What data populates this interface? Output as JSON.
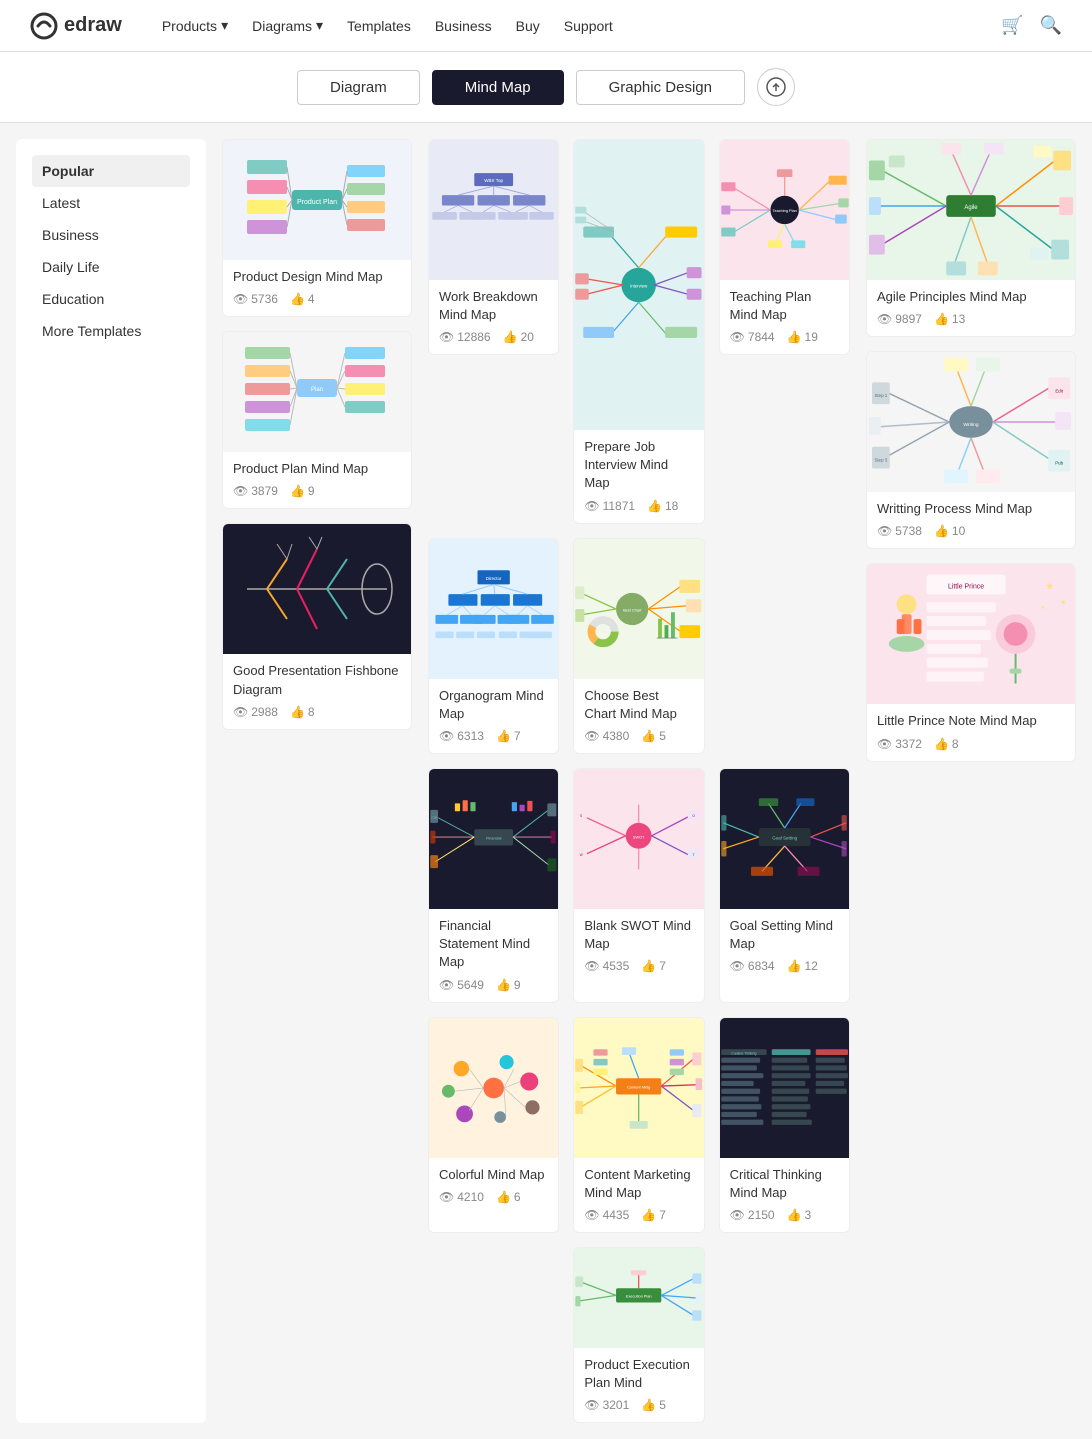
{
  "header": {
    "logo_text": "edraw",
    "nav_items": [
      {
        "label": "Products",
        "has_arrow": true
      },
      {
        "label": "Diagrams",
        "has_arrow": true
      },
      {
        "label": "Templates",
        "has_arrow": false
      },
      {
        "label": "Business",
        "has_arrow": false
      },
      {
        "label": "Buy",
        "has_arrow": false
      },
      {
        "label": "Support",
        "has_arrow": false
      }
    ]
  },
  "toolbar": {
    "tabs": [
      {
        "label": "Diagram",
        "active": false
      },
      {
        "label": "Mind Map",
        "active": true
      },
      {
        "label": "Graphic Design",
        "active": false
      }
    ],
    "upload_title": "Upload"
  },
  "sidebar": {
    "items": [
      {
        "label": "Popular",
        "active": true
      },
      {
        "label": "Latest",
        "active": false
      },
      {
        "label": "Business",
        "active": false
      },
      {
        "label": "Daily Life",
        "active": false
      },
      {
        "label": "Education",
        "active": false
      },
      {
        "label": "More Templates",
        "active": false
      }
    ]
  },
  "cards": {
    "side_col": [
      {
        "title": "Product Design Mind Map",
        "views": "5736",
        "likes": "4",
        "bg": "light",
        "colors": [
          "#7dc",
          "#f9a",
          "#9cf",
          "#fc9"
        ]
      },
      {
        "title": "Product Plan Mind Map",
        "views": "3879",
        "likes": "9",
        "bg": "light",
        "colors": [
          "#7dc",
          "#f9a",
          "#9cf"
        ]
      },
      {
        "title": "Good Presentation Fishbone Diagram",
        "views": "2988",
        "likes": "8",
        "bg": "dark"
      }
    ],
    "main_grid": [
      {
        "col": 0,
        "row": 0,
        "title": "Work Breakdown Mind Map",
        "views": "12886",
        "likes": "20",
        "bg": "light_blue"
      },
      {
        "col": 0,
        "row": 1,
        "title": "Organogram Mind Map",
        "views": "6313",
        "likes": "7",
        "bg": "blue_dark"
      },
      {
        "col": 0,
        "row": 2,
        "title": "Financial Statement Mind Map",
        "views": "5649",
        "likes": "9",
        "bg": "dark"
      },
      {
        "col": 0,
        "row": 3,
        "title": "Colorful Mind Map",
        "views": "4210",
        "likes": "6",
        "bg": "light"
      },
      {
        "col": 1,
        "row_span": 2,
        "title": "Prepare Job Interview Mind Map",
        "views": "11871",
        "likes": "18",
        "bg": "teal"
      },
      {
        "col": 1,
        "row": 1,
        "title": "Blank SWOT Mind Map",
        "views": "4535",
        "likes": "7",
        "bg": "pink"
      },
      {
        "col": 1,
        "row": 2,
        "title": "Content Marketing Mind Map",
        "views": "4435",
        "likes": "7",
        "bg": "colorful"
      },
      {
        "col": 1,
        "row": 3,
        "title": "Product Execution Plan Mind",
        "views": "3201",
        "likes": "5",
        "bg": "light"
      },
      {
        "col": 2,
        "row": 0,
        "title": "Teaching Plan Mind Map",
        "views": "7844",
        "likes": "19",
        "bg": "light"
      },
      {
        "col": 2,
        "row": 1,
        "title": "Choose Best Chart Mind Map",
        "views": "4380",
        "likes": "5",
        "bg": "light_green"
      },
      {
        "col": 2,
        "row": 2,
        "title": "Goal Setting Mind Map",
        "views": "6834",
        "likes": "12",
        "bg": "dark"
      },
      {
        "col": 2,
        "row": 3,
        "title": "Critical Thinking Mind Map",
        "views": "2150",
        "likes": "3",
        "bg": "dark"
      }
    ],
    "right_col": [
      {
        "title": "Agile Principles Mind Map",
        "views": "9897",
        "likes": "13",
        "bg": "light_multi"
      },
      {
        "title": "Writting Process Mind Map",
        "views": "5738",
        "likes": "10",
        "bg": "gray_center"
      },
      {
        "title": "Little Prince Note Mind Map",
        "views": "3372",
        "likes": "8",
        "bg": "pink_light"
      }
    ]
  }
}
